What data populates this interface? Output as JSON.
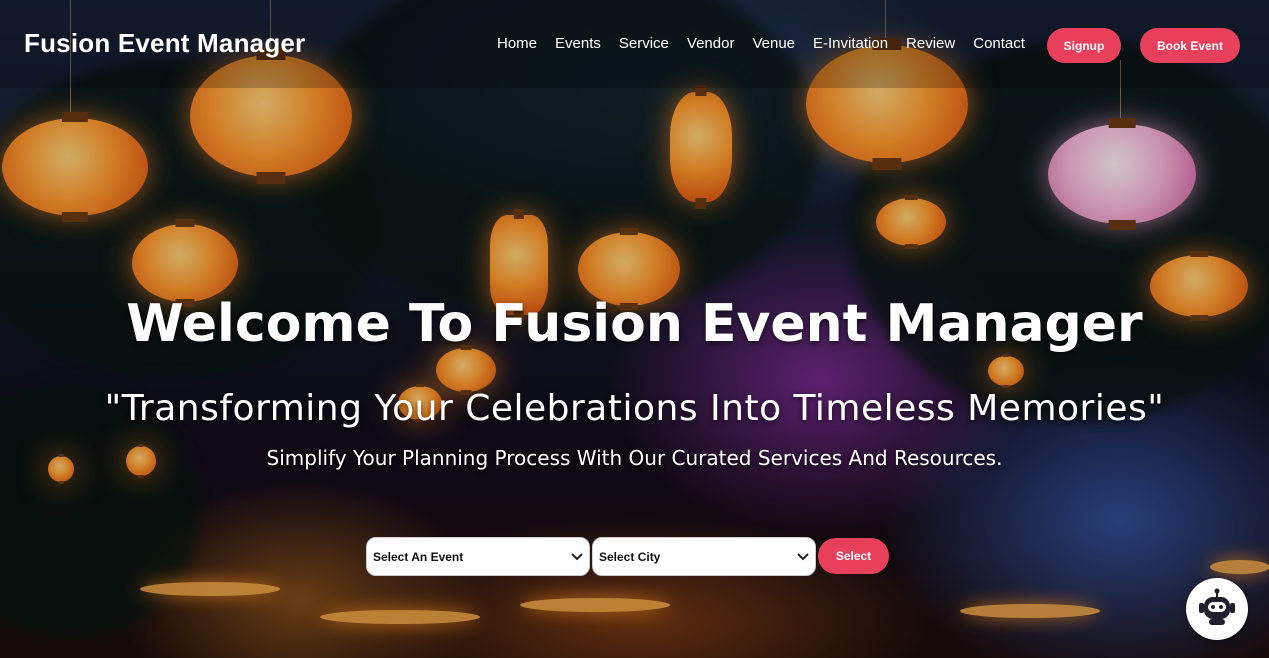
{
  "brand": {
    "name": "Fusion Event Manager"
  },
  "nav": {
    "links": [
      "Home",
      "Events",
      "Service",
      "Vendor",
      "Venue",
      "E-Invitation",
      "Review",
      "Contact"
    ],
    "signup_label": "Signup",
    "book_label": "Book Event"
  },
  "hero": {
    "title": "Welcome To Fusion Event Manager",
    "tagline": "\"Transforming Your Celebrations Into Timeless Memories\"",
    "subtitle": "Simplify Your Planning Process With Our Curated Services And Resources."
  },
  "search": {
    "event_select": "Select An Event",
    "city_select": "Select City",
    "submit_label": "Select"
  },
  "chatbot": {
    "icon": "robot-icon"
  },
  "colors": {
    "accent": "#e8405a",
    "text": "#ffffff"
  }
}
